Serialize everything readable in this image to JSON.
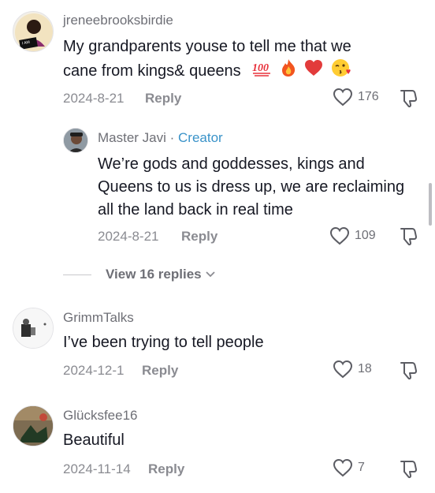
{
  "comments": [
    {
      "username": "jreneebrooksbirdie",
      "text_line1": "My grandparents youse to tell me that we",
      "text_line2": "cane from kings& queens",
      "emojis": [
        "hundred-points-icon",
        "fire-icon",
        "red-heart-icon",
        "face-blowing-kiss-icon"
      ],
      "avatar_text": "I AM\nPASSIONATE",
      "date": "2024-8-21",
      "reply_label": "Reply",
      "likes": "176"
    },
    {
      "username": "Master Javi",
      "creator_sep": " · ",
      "creator_label": "Creator",
      "text": "We’re gods and goddesses, kings and Queens to us is dress up, we are reclaiming all the land back in real time",
      "date": "2024-8-21",
      "reply_label": "Reply",
      "likes": "109"
    },
    {
      "username": "GrimmTalks",
      "text": "I’ve been trying to tell people",
      "date": "2024-12-1",
      "reply_label": "Reply",
      "likes": "18"
    },
    {
      "username": "Glücksfee16",
      "text": "Beautiful",
      "date": "2024-11-14",
      "reply_label": "Reply",
      "likes": "7"
    }
  ],
  "view_replies": {
    "label": "View 16 replies"
  },
  "colors": {
    "creator": "#3a93c9",
    "heart": "#e8323c",
    "text": "#161823",
    "muted": "#8a8b91"
  }
}
